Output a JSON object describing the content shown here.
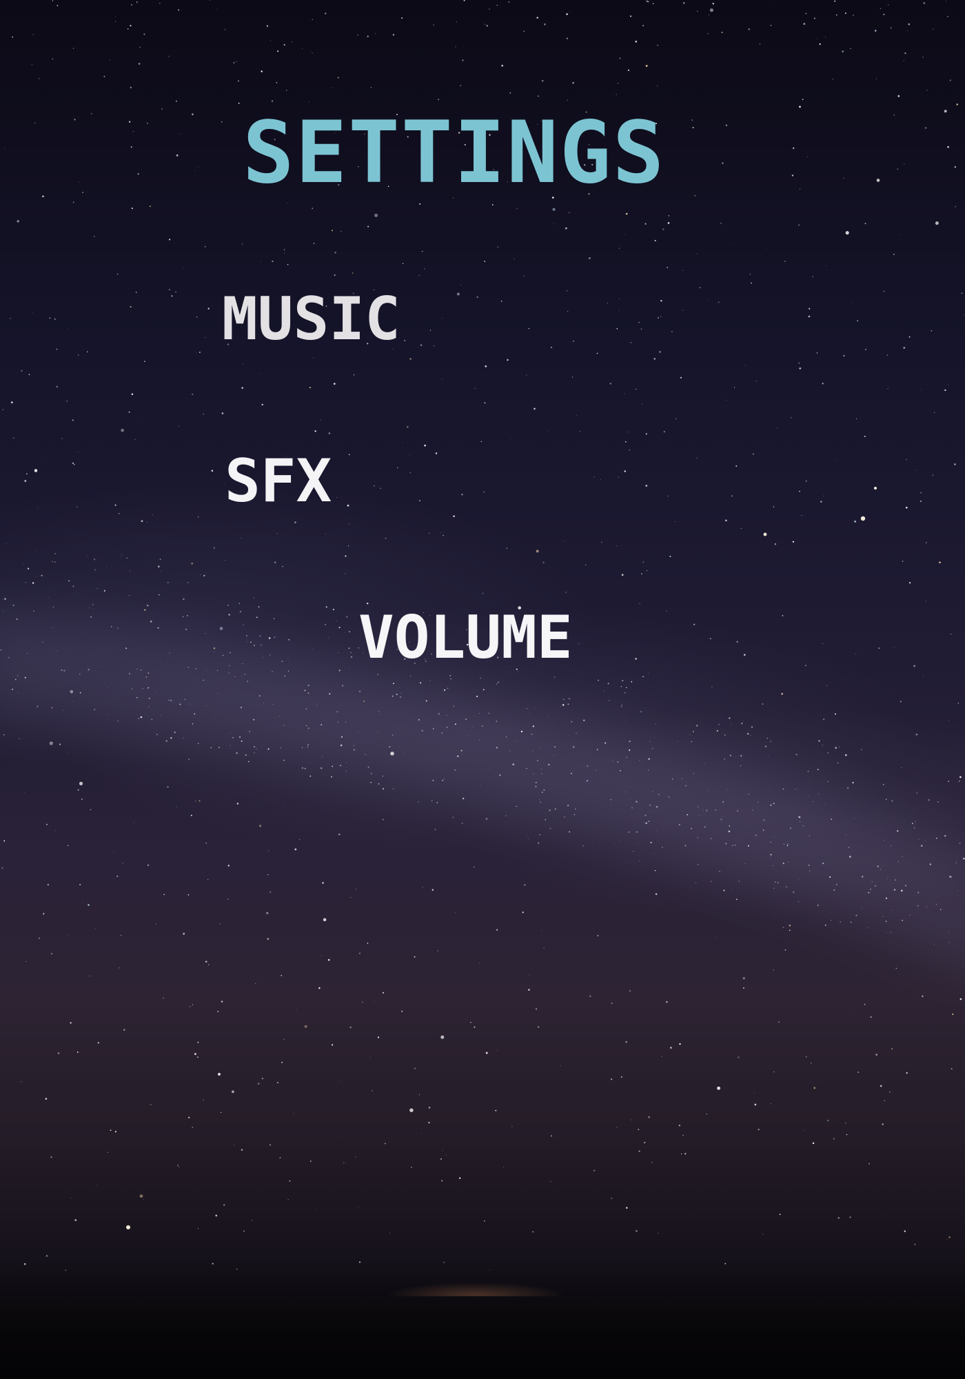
{
  "settings_menu": {
    "title": "SETTINGS",
    "items": [
      {
        "label": "MUSIC"
      },
      {
        "label": "SFX"
      },
      {
        "label": "VOLUME"
      }
    ]
  },
  "colors": {
    "title": "#7dc4d3",
    "item_text": "#f2f1f3",
    "sky_top": "#0c0a16",
    "sky_horizon": "#2d2333"
  },
  "background": "starry-night-sky"
}
